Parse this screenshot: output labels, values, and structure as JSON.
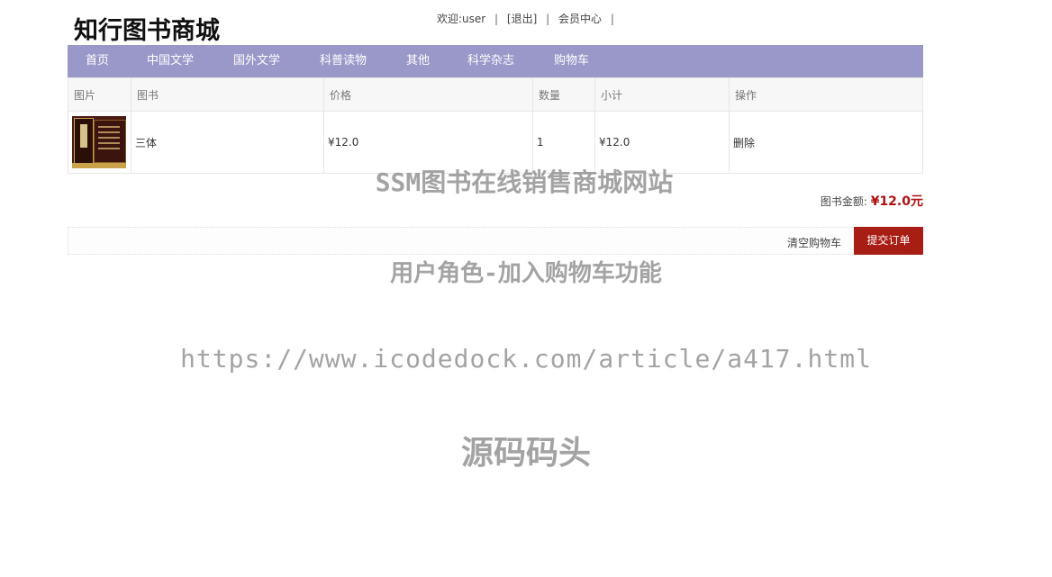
{
  "site": {
    "logo": "知行图书商城"
  },
  "userbar": {
    "welcome": "欢迎:user",
    "sep1": "|",
    "logout": "[退出]",
    "sep2": "|",
    "member_center": "会员中心",
    "sep3": "|"
  },
  "nav": {
    "items": [
      {
        "label": "首页"
      },
      {
        "label": "中国文学"
      },
      {
        "label": "国外文学"
      },
      {
        "label": "科普读物"
      },
      {
        "label": "其他"
      },
      {
        "label": "科学杂志"
      },
      {
        "label": "购物车"
      }
    ]
  },
  "cart": {
    "headers": [
      "图片",
      "图书",
      "价格",
      "数量",
      "小计",
      "操作"
    ],
    "rows": [
      {
        "image": "book-cover",
        "title": "三体",
        "price": "¥12.0",
        "quantity": "1",
        "subtotal": "¥12.0",
        "action": "删除"
      }
    ],
    "total_label": "图书金额:",
    "total_value": "¥12.0元",
    "clear_label": "清空购物车",
    "submit_label": "提交订单"
  },
  "watermark": {
    "line1": "SSM图书在线销售商城网站",
    "line2": "用户角色-加入购物车功能",
    "line3": "https://www.icodedock.com/article/a417.html",
    "line4": "源码码头"
  },
  "colors": {
    "nav_bg": "#9a98c9",
    "submit_bg": "#a81e14",
    "total_amount": "#b01010"
  }
}
